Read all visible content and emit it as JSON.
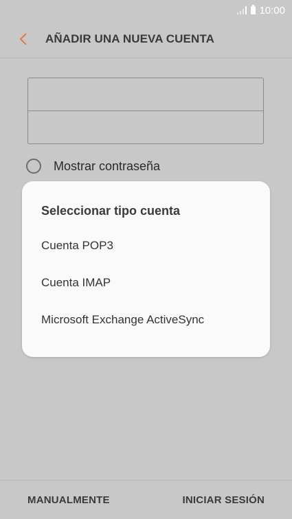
{
  "status_bar": {
    "time": "10:00",
    "signal_icon": "signal-icon",
    "battery_icon": "battery-icon"
  },
  "header": {
    "title": "AÑADIR UNA NUEVA CUENTA",
    "back_icon": "chevron-left-icon",
    "accent_color": "#e07a4e"
  },
  "form": {
    "email_value": "",
    "password_value": "",
    "show_password_label": "Mostrar contraseña"
  },
  "dialog": {
    "title": "Seleccionar tipo cuenta",
    "options": [
      {
        "label": "Cuenta POP3"
      },
      {
        "label": "Cuenta IMAP"
      },
      {
        "label": "Microsoft Exchange ActiveSync"
      }
    ]
  },
  "bottom_bar": {
    "manual_label": "MANUALMENTE",
    "signin_label": "INICIAR SESIÓN"
  }
}
